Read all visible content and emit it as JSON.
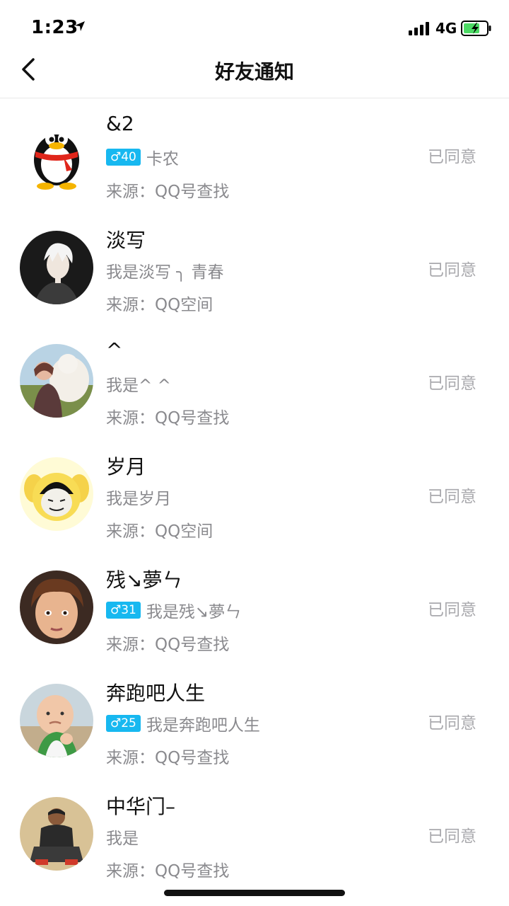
{
  "status_bar": {
    "time": "1:23",
    "network": "4G",
    "icons": [
      "location-arrow-icon",
      "signal-icon",
      "battery-charging-icon"
    ]
  },
  "nav": {
    "title": "好友通知",
    "back_icon": "chevron-left-icon"
  },
  "colors": {
    "badge": "#17b8f0",
    "status_text": "#a9a9ad",
    "secondary_text": "#8a8a8e"
  },
  "items": [
    {
      "name": "&2",
      "badge": "♂40",
      "message": "卡农",
      "source": "来源：QQ号查找",
      "status": "已同意"
    },
    {
      "name": "淡写",
      "badge": "",
      "message": "我是淡写 ╮ 青春",
      "source": "来源：QQ空间",
      "status": "已同意"
    },
    {
      "name": "^",
      "badge": "",
      "message": "我是^ ^",
      "source": "来源：QQ号查找",
      "status": "已同意"
    },
    {
      "name": "岁月",
      "badge": "",
      "message": "我是岁月",
      "source": "来源：QQ空间",
      "status": "已同意"
    },
    {
      "name": "残↘夢ㄣ",
      "badge": "♂31",
      "message": "我是残↘夢ㄣ",
      "source": "来源：QQ号查找",
      "status": "已同意"
    },
    {
      "name": "奔跑吧人生",
      "badge": "♂25",
      "message": "我是奔跑吧人生",
      "source": "来源：QQ号查找",
      "status": "已同意"
    },
    {
      "name": "中华门–",
      "badge": "",
      "message": "我是",
      "source": "来源：QQ号查找",
      "status": "已同意"
    }
  ]
}
